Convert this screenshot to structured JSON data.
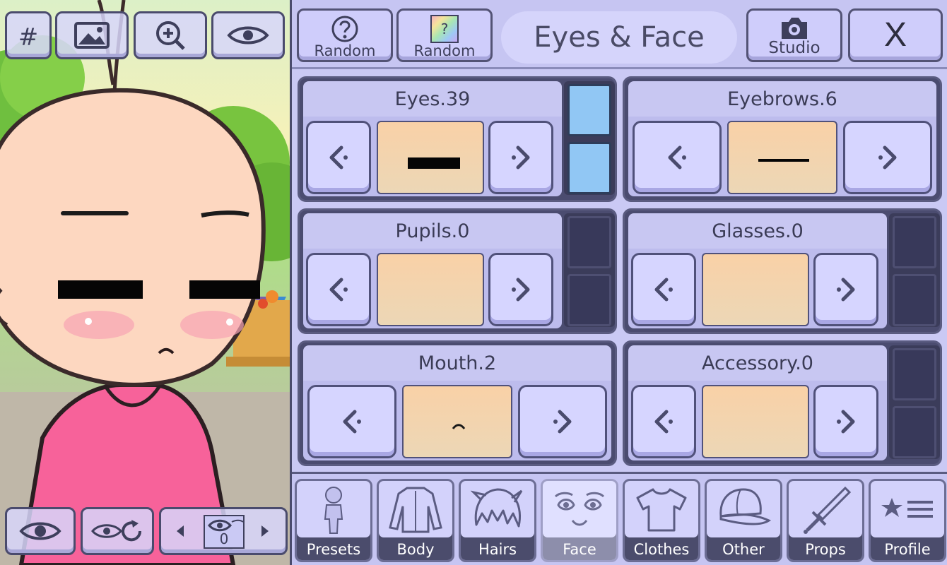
{
  "toolbar": {
    "hash_label": "#",
    "random_label": "Random",
    "random_color_label": "Random",
    "random_color_mark": "?",
    "title": "Eyes & Face",
    "studio_label": "Studio",
    "close_label": "X"
  },
  "cards": {
    "eyes": {
      "title": "Eyes.39"
    },
    "eyebrows": {
      "title": "Eyebrows.6"
    },
    "pupils": {
      "title": "Pupils.0"
    },
    "glasses": {
      "title": "Glasses.0"
    },
    "mouth": {
      "title": "Mouth.2"
    },
    "accessory": {
      "title": "Accessory.0"
    }
  },
  "tabs": [
    {
      "label": "Presets"
    },
    {
      "label": "Body"
    },
    {
      "label": "Hairs"
    },
    {
      "label": "Face"
    },
    {
      "label": "Clothes"
    },
    {
      "label": "Other"
    },
    {
      "label": "Props"
    },
    {
      "label": "Profile"
    }
  ],
  "selected_tab": "Face",
  "pose": {
    "value": "0"
  },
  "colors": {
    "panel": "#cac9f4",
    "button": "#cfcdfb",
    "border": "#535375",
    "preview": "#f4d3ad",
    "eye_slot": "#91c7f4",
    "shirt": "#f7629a",
    "skin": "#fdd7c0"
  }
}
